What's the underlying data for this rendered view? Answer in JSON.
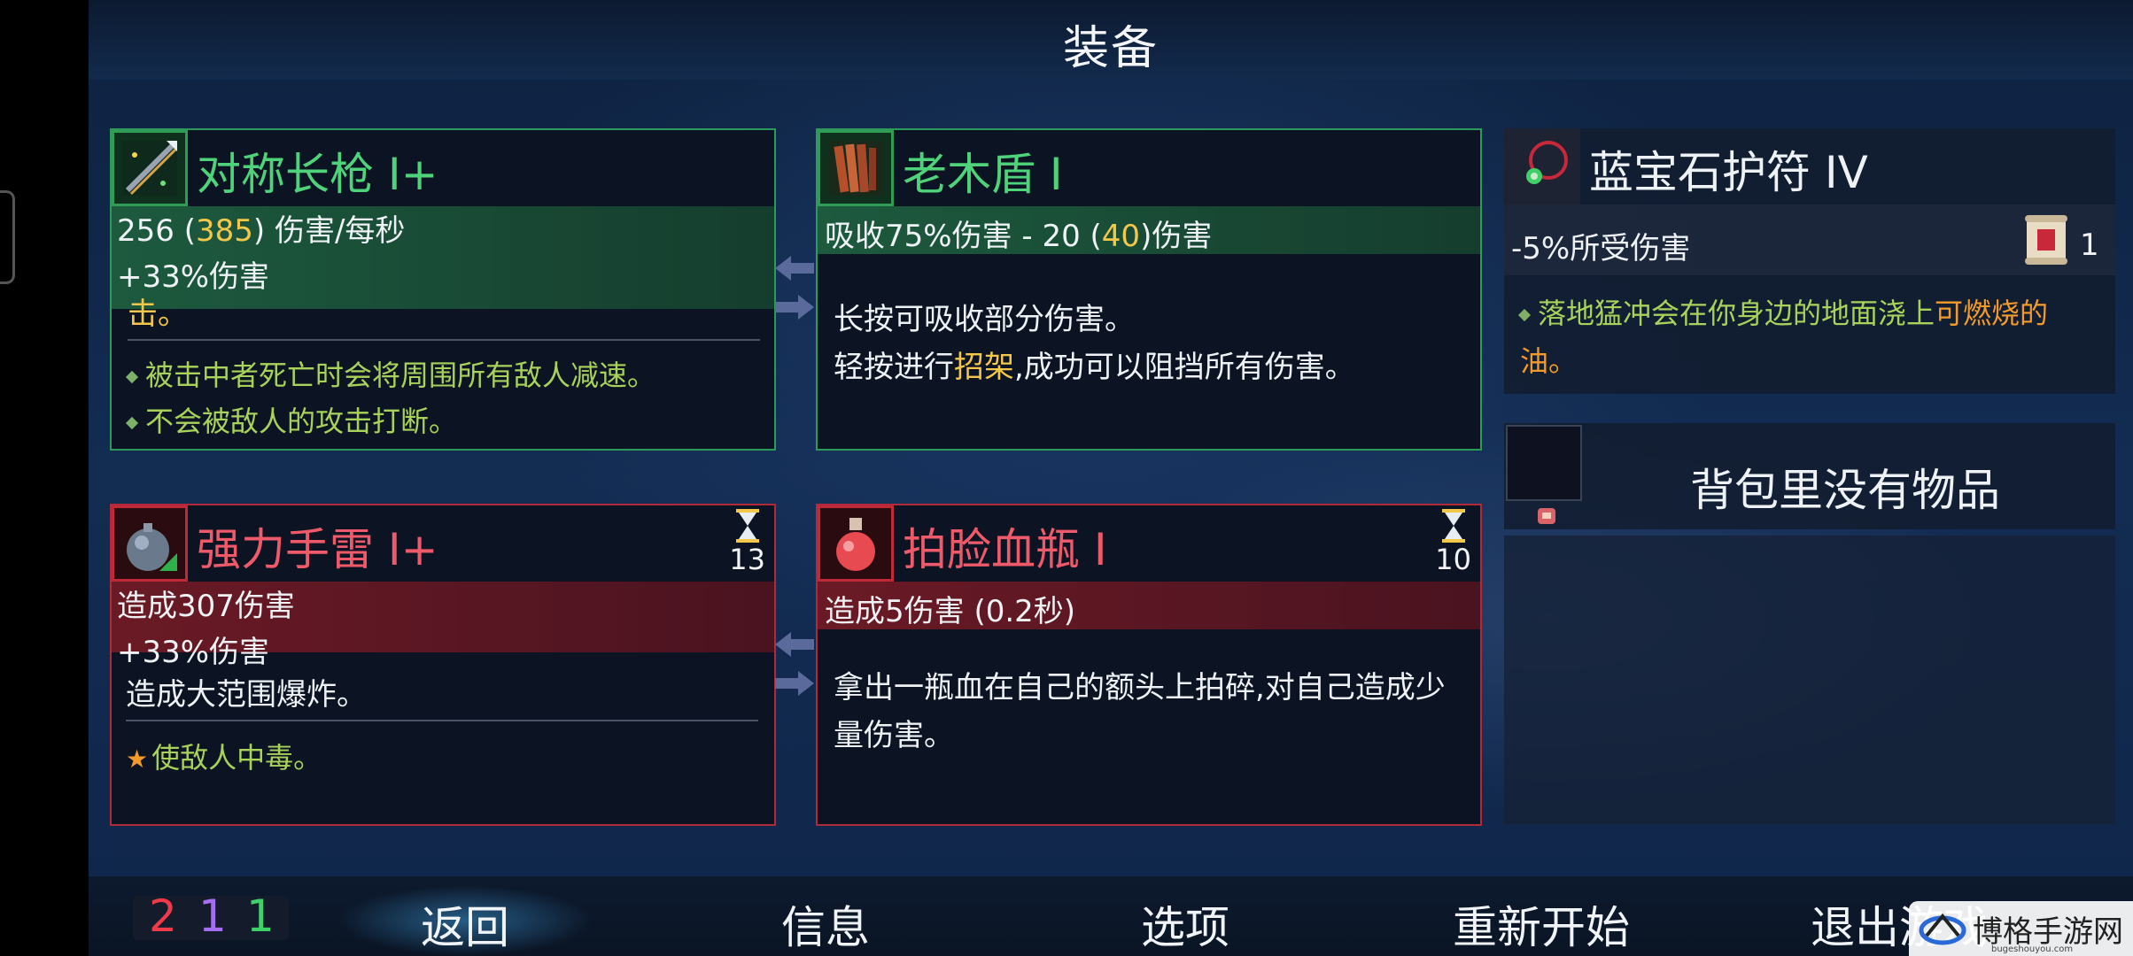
{
  "title": "装备",
  "weapon1": {
    "name": "对称长枪 I+",
    "stat_prefix": "256 (",
    "stat_yellow": "385",
    "stat_suffix": ") 伤害/每秒",
    "bonus": "+33%伤害",
    "desc_partial": "击。",
    "bullets": [
      "被击中者死亡时会将周围所有敌人减速。",
      "不会被敌人的攻击打断。"
    ]
  },
  "shield": {
    "name": "老木盾 I",
    "stat_prefix": "吸收75%伤害 - 20 (",
    "stat_yellow": "40",
    "stat_suffix": ")伤害",
    "desc1": "长按可吸收部分伤害。",
    "desc2_prefix": "轻按进行",
    "desc2_yellow": "招架",
    "desc2_suffix": ",成功可以阻挡所有伤害。"
  },
  "amulet": {
    "name": "蓝宝石护符 IV",
    "stat": "-5%所受伤害",
    "scroll_count": "1",
    "desc_prefix": "落地猛冲会在你身边的地面浇上",
    "desc_orange": "可燃烧的",
    "desc_line2": "油。"
  },
  "grenade": {
    "name": "强力手雷 I+",
    "cooldown": "13",
    "stat": "造成307伤害",
    "bonus": "+33%伤害",
    "desc": "造成大范围爆炸。",
    "bullet": "使敌人中毒。"
  },
  "potion": {
    "name": "拍脸血瓶 I",
    "cooldown": "10",
    "stat": "造成5伤害 (0.2秒)",
    "desc_line1": "拿出一瓶血在自己的额头上拍碎,对自己造成少",
    "desc_line2": "量伤害。"
  },
  "backpack": {
    "empty_text": "背包里没有物品"
  },
  "scrolls": {
    "red": "2",
    "purple": "1",
    "green": "1"
  },
  "menu": {
    "back": "返回",
    "info": "信息",
    "options": "选项",
    "restart": "重新开始",
    "quit": "退出游戏"
  },
  "watermark": "博格手游网",
  "watermark_url": "bugeshouyou.com",
  "colors": {
    "green": "#4fd37a",
    "red": "#ef5a6a",
    "yellow": "#f2c74a",
    "orange": "#f39a2a",
    "purple": "#a56ef0"
  },
  "icons": [
    "spear-icon",
    "wooden-shield-icon",
    "sapphire-amulet-icon",
    "grenade-icon",
    "potion-icon",
    "hourglass-icon",
    "scroll-icon",
    "backpack-slot-icon"
  ]
}
